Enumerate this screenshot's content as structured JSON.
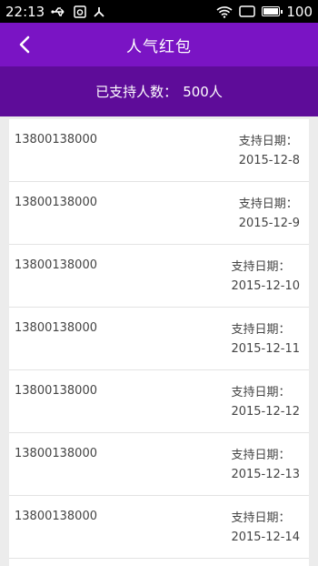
{
  "statusbar": {
    "time": "22:13",
    "battery": "100",
    "icons": [
      "usb-icon",
      "image-notification-icon",
      "share-icon",
      "wifi-icon",
      "rotate-icon",
      "battery-icon"
    ]
  },
  "header": {
    "title": "人气红包",
    "back_icon": "chevron-left-icon"
  },
  "summary": {
    "label": "已支持人数：",
    "count": "500人"
  },
  "records": [
    {
      "phone": "13800138000",
      "date_label": "支持日期：",
      "date": "2015-12-8"
    },
    {
      "phone": "13800138000",
      "date_label": "支持日期：",
      "date": "2015-12-9"
    },
    {
      "phone": "13800138000",
      "date_label": "支持日期：",
      "date": "2015-12-10"
    },
    {
      "phone": "13800138000",
      "date_label": "支持日期：",
      "date": "2015-12-11"
    },
    {
      "phone": "13800138000",
      "date_label": "支持日期：",
      "date": "2015-12-12"
    },
    {
      "phone": "13800138000",
      "date_label": "支持日期：",
      "date": "2015-12-13"
    },
    {
      "phone": "13800138000",
      "date_label": "支持日期：",
      "date": "2015-12-14"
    }
  ],
  "colors": {
    "header": "#7a14c4",
    "summary_bar": "#5e0c99",
    "background": "#ececec"
  }
}
